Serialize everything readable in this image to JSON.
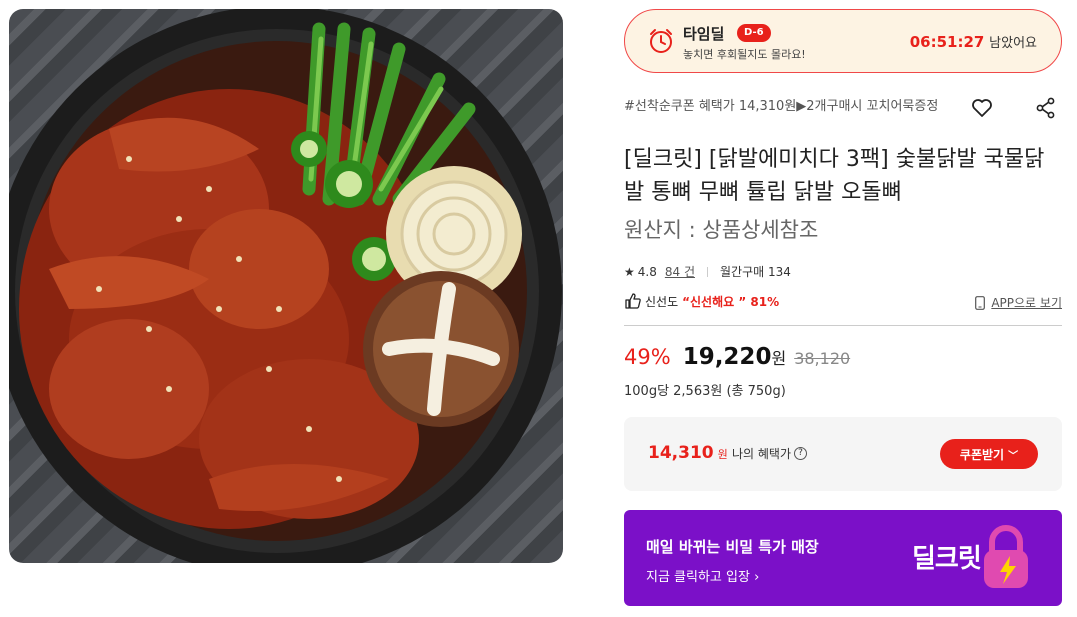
{
  "timedeal": {
    "title": "타임딜",
    "dday": "D-6",
    "subtitle": "놓치면 후회될지도 몰라요!",
    "countdown": "06:51:27",
    "countdown_suffix": "남았어요"
  },
  "product": {
    "promo": "#선착순쿠폰 혜택가 14,310원▶2개구매시 꼬치어묵증정",
    "name": "[딜크릿] [닭발에미치다 3팩] 숯불닭발 국물닭발 통뼈 무뼈 튤립 닭발 오돌뼈",
    "origin": "원산지 : 상품상세참조",
    "rating": "4.8",
    "review_count": "84 건",
    "monthly_purchase": "월간구매 134",
    "freshness_label": "신선도",
    "freshness_value": "“신선해요 ” 81%",
    "app_link": "APP으로 보기"
  },
  "price": {
    "discount_rate": "49%",
    "sale_price": "19,220",
    "won": "원",
    "original_price": "38,120",
    "unit_price": "100g당 2,563원 (총 750g)"
  },
  "benefit": {
    "amount": "14,310",
    "unit": "원",
    "label": "나의 혜택가",
    "coupon_button": "쿠폰받기"
  },
  "banner": {
    "headline": "매일 바뀌는 비밀 특가 매장",
    "cta": "지금 클릭하고 입장 ›",
    "logo_text": "딜크릿"
  },
  "icons": {
    "timedeal": "alarm-clock-icon",
    "heart": "heart-icon",
    "share": "share-icon",
    "thumbs_up": "thumbs-up-icon",
    "phone": "phone-icon",
    "help": "question-icon",
    "lock": "lightning-lock-icon"
  },
  "colors": {
    "accent": "#e8211b",
    "banner": "#7b10c8",
    "timedeal_bg": "#fdf3e3"
  }
}
